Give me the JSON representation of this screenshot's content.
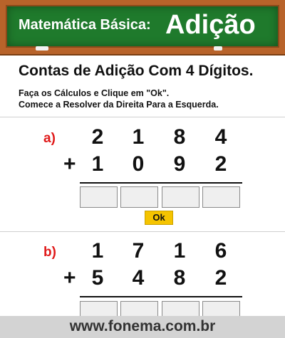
{
  "header": {
    "subtitle": "Matemática Básica:",
    "title": "Adição"
  },
  "page": {
    "title": "Contas de Adição Com 4 Dígitos.",
    "instruction_1": "Faça os Cálculos e Clique em \"Ok\".",
    "instruction_2": "Comece a Resolver da Direita Para a Esquerda."
  },
  "problems": [
    {
      "label": "a)",
      "top_digits": [
        "2",
        "1",
        "8",
        "4"
      ],
      "bottom_digits": [
        "1",
        "0",
        "9",
        "2"
      ],
      "operator": "+",
      "answers": [
        "",
        "",
        "",
        ""
      ],
      "ok_label": "Ok"
    },
    {
      "label": "b)",
      "top_digits": [
        "1",
        "7",
        "1",
        "6"
      ],
      "bottom_digits": [
        "5",
        "4",
        "8",
        "2"
      ],
      "operator": "+",
      "answers": [
        "",
        "",
        "",
        ""
      ]
    }
  ],
  "footer": {
    "site": "www.fonema.com.br"
  },
  "colors": {
    "board": "#1f7a2c",
    "frame": "#b8632a",
    "label_red": "#e01a1a",
    "ok_yellow": "#f5c400"
  }
}
